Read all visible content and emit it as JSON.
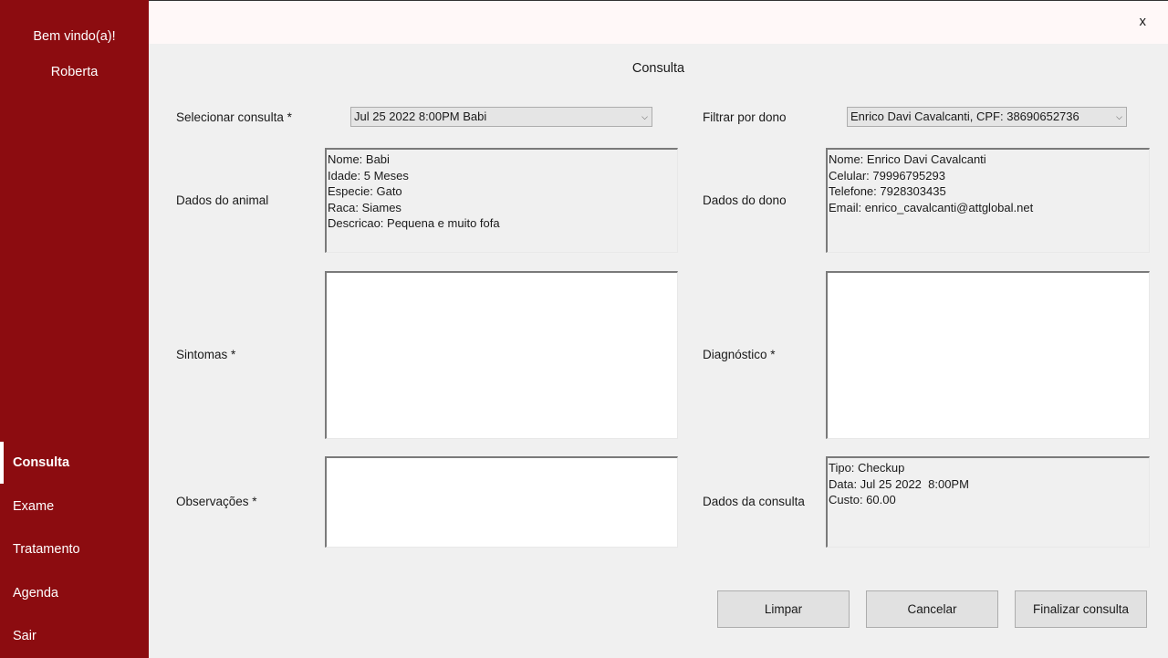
{
  "sidebar": {
    "welcome": "Bem vindo(a)!",
    "username": "Roberta",
    "items": [
      {
        "label": "Consulta",
        "active": true
      },
      {
        "label": "Exame"
      },
      {
        "label": "Tratamento"
      },
      {
        "label": "Agenda"
      },
      {
        "label": "Sair"
      }
    ]
  },
  "window": {
    "close_label": "x"
  },
  "form": {
    "title": "Consulta",
    "select_consulta": {
      "label": "Selecionar consulta *",
      "value": "Jul 25 2022  8:00PM Babi"
    },
    "filtrar_dono": {
      "label": "Filtrar por dono",
      "value": "Enrico Davi Cavalcanti, CPF: 38690652736"
    },
    "dados_animal": {
      "label": "Dados do animal",
      "lines": [
        "Nome: Babi",
        "Idade: 5 Meses",
        "Especie: Gato",
        "Raca: Siames",
        "Descricao: Pequena e muito fofa"
      ]
    },
    "dados_dono": {
      "label": "Dados do dono",
      "lines": [
        "Nome: Enrico Davi Cavalcanti",
        "Celular: 79996795293",
        "Telefone: 7928303435",
        "Email: enrico_cavalcanti@attglobal.net"
      ]
    },
    "sintomas": {
      "label": "Sintomas *",
      "value": ""
    },
    "diagnostico": {
      "label": "Diagnóstico *",
      "value": ""
    },
    "observacoes": {
      "label": "Observações *",
      "value": ""
    },
    "dados_consulta": {
      "label": "Dados da consulta",
      "lines": [
        "Tipo: Checkup",
        "Data: Jul 25 2022  8:00PM",
        "Custo: 60.00"
      ]
    }
  },
  "buttons": {
    "limpar": "Limpar",
    "cancelar": "Cancelar",
    "finalizar": "Finalizar consulta"
  },
  "colors": {
    "sidebar": "#8c0c10",
    "background": "#f0f0f0",
    "topbar": "#fff8f8"
  },
  "icons": {
    "dropdown": "chevron-down-icon"
  }
}
